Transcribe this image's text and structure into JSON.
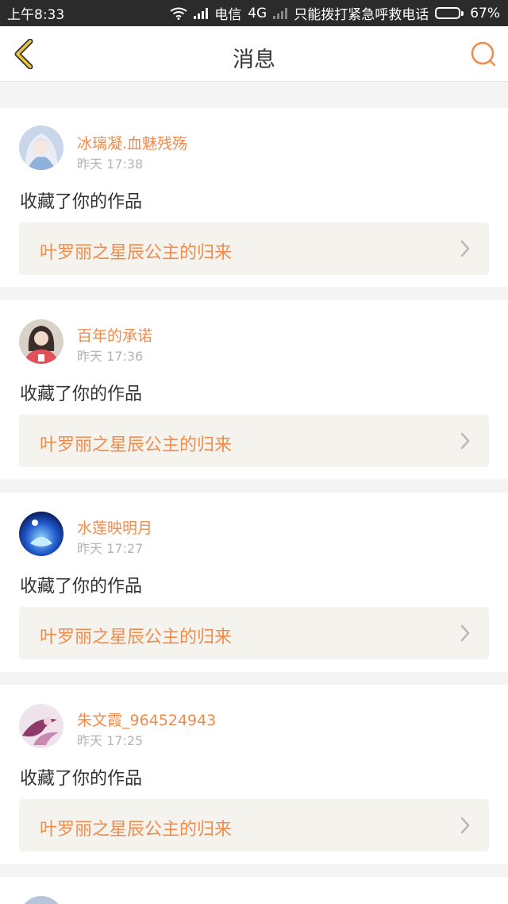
{
  "status_bar": {
    "time": "上午8:33",
    "carrier": "电信",
    "network": "4G",
    "emergency_text": "只能拨打紧急呼救电话",
    "battery": "67%",
    "battery_level": 0.67
  },
  "nav": {
    "title": "消息",
    "back_icon": "chevron-left-icon",
    "search_icon": "search-icon",
    "accent_color": "#ef8c4d",
    "back_color": "#e9c53b"
  },
  "messages": [
    {
      "user": "冰璃凝.血魅残殇",
      "time": "昨天 17:38",
      "action": "收藏了你的作品",
      "work_title": "叶罗丽之星辰公主的归来"
    },
    {
      "user": "百年的承诺",
      "time": "昨天 17:36",
      "action": "收藏了你的作品",
      "work_title": "叶罗丽之星辰公主的归来"
    },
    {
      "user": "水莲映明月",
      "time": "昨天 17:27",
      "action": "收藏了你的作品",
      "work_title": "叶罗丽之星辰公主的归来"
    },
    {
      "user": "朱文霞_964524943",
      "time": "昨天 17:25",
      "action": "收藏了你的作品",
      "work_title": "叶罗丽之星辰公主的归来"
    }
  ]
}
